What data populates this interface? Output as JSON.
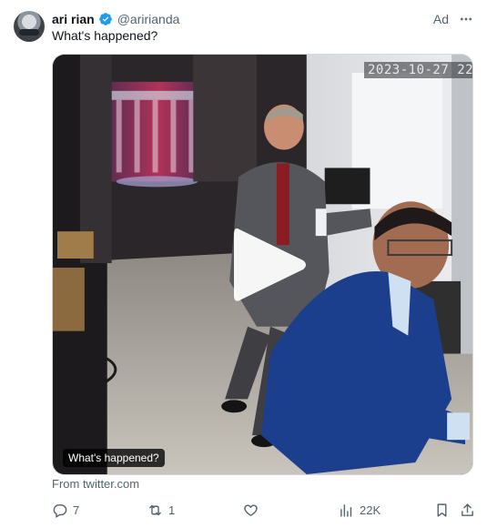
{
  "tweet": {
    "author_name": "ari rian",
    "handle": "@aririanda",
    "ad_label": "Ad",
    "text": "What's happened?",
    "verified_icon": "verified-badge-icon",
    "more_icon": "more-dots-icon"
  },
  "media": {
    "timestamp": "2023-10-27  22:",
    "caption": "What's happened?",
    "play_icon": "play-icon"
  },
  "source": "From twitter.com",
  "actions": {
    "replies": "7",
    "reposts": "1",
    "likes": "",
    "views": "22K"
  },
  "colors": {
    "accent": "#1d9bf0",
    "secondary_text": "#536471",
    "primary_text": "#0f1419"
  }
}
